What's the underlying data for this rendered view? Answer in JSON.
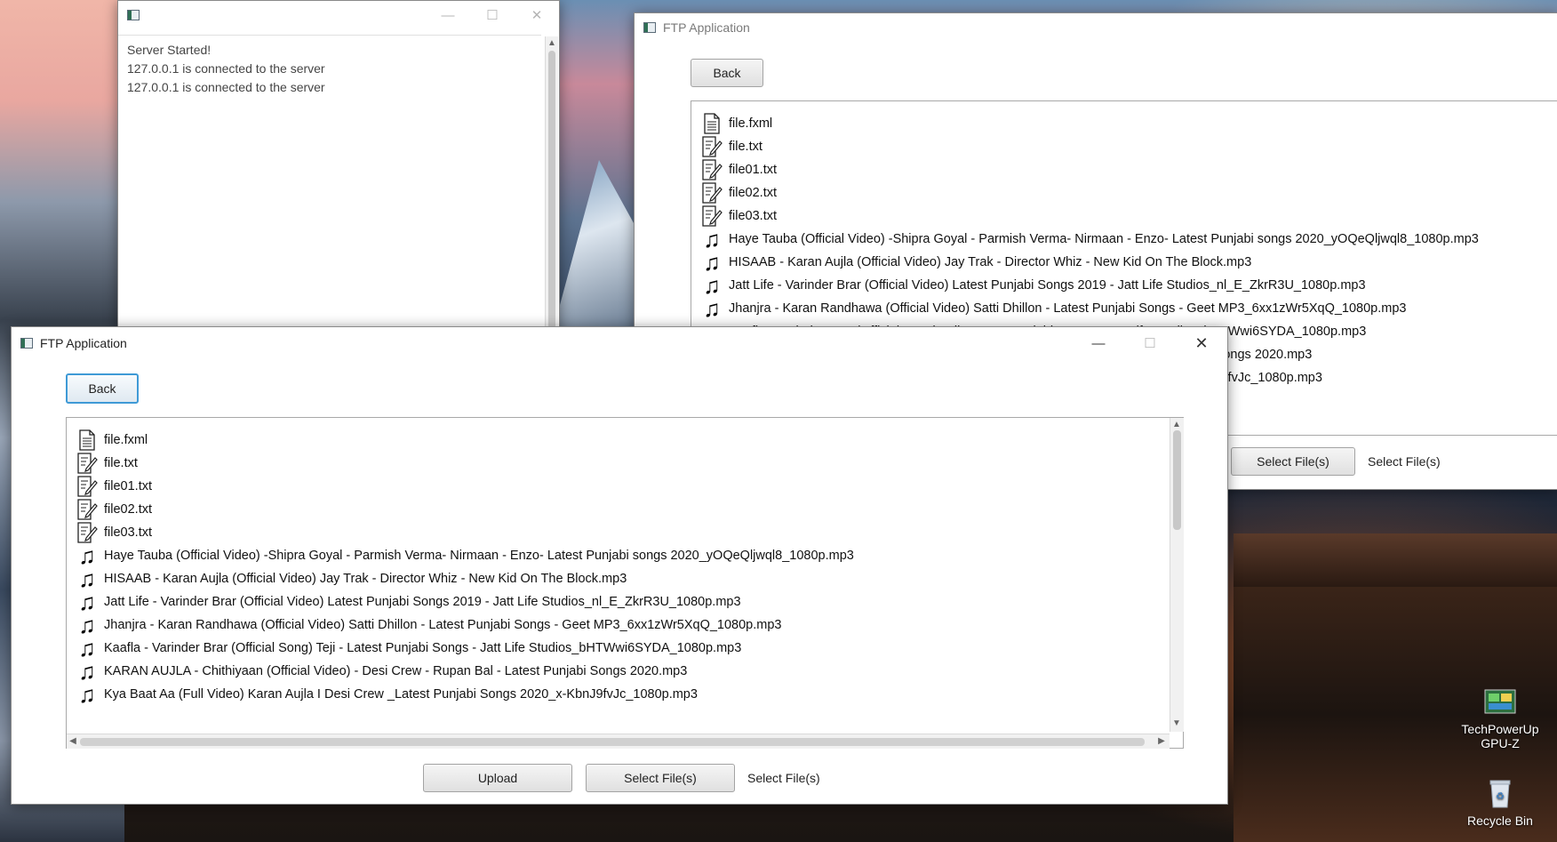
{
  "server_window": {
    "title": "",
    "log_lines": [
      "Server Started!",
      "127.0.0.1 is connected to the server",
      "127.0.0.1 is connected to the server"
    ]
  },
  "bg_window": {
    "title": "FTP Application",
    "back_label": "Back",
    "select_button_label": "Select File(s)",
    "select_status": "Select File(s)",
    "files": [
      {
        "icon": "document-icon",
        "name": "file.fxml"
      },
      {
        "icon": "text-file-icon",
        "name": "file.txt"
      },
      {
        "icon": "text-file-icon",
        "name": "file01.txt"
      },
      {
        "icon": "text-file-icon",
        "name": "file02.txt"
      },
      {
        "icon": "text-file-icon",
        "name": "file03.txt"
      },
      {
        "icon": "music-note-icon",
        "name": "Haye Tauba (Official Video) -Shipra Goyal - Parmish Verma- Nirmaan - Enzo- Latest Punjabi songs 2020_yOQeQljwql8_1080p.mp3"
      },
      {
        "icon": "music-note-icon",
        "name": "HISAAB - Karan Aujla (Official Video) Jay Trak - Director Whiz - New Kid On The Block.mp3"
      },
      {
        "icon": "music-note-icon",
        "name": "Jatt Life - Varinder Brar (Official Video) Latest Punjabi Songs 2019 - Jatt Life Studios_nl_E_ZkrR3U_1080p.mp3"
      },
      {
        "icon": "music-note-icon",
        "name": "Jhanjra - Karan Randhawa (Official Video) Satti Dhillon - Latest Punjabi Songs - Geet MP3_6xx1zWr5XqQ_1080p.mp3"
      },
      {
        "icon": "music-note-icon",
        "name": "Kaafla - Varinder Brar (Official Song) Teji - Latest Punjabi Songs - Jatt Life Studios_bHTWwi6SYDA_1080p.mp3"
      },
      {
        "icon": "music-note-icon",
        "name": "KARAN AUJLA - Chithiyaan (Official Video) - Desi Crew - Rupan Bal - Latest Punjabi Songs 2020.mp3"
      },
      {
        "icon": "music-note-icon",
        "name": "Kya Baat Aa (Full Video) Karan Aujla I Desi Crew _Latest Punjabi Songs 2020_x-KbnJ9fvJc_1080p.mp3"
      }
    ]
  },
  "main_window": {
    "title": "FTP Application",
    "back_label": "Back",
    "upload_label": "Upload",
    "select_button_label": "Select File(s)",
    "select_status": "Select File(s)",
    "files": [
      {
        "icon": "document-icon",
        "name": "file.fxml"
      },
      {
        "icon": "text-file-icon",
        "name": "file.txt"
      },
      {
        "icon": "text-file-icon",
        "name": "file01.txt"
      },
      {
        "icon": "text-file-icon",
        "name": "file02.txt"
      },
      {
        "icon": "text-file-icon",
        "name": "file03.txt"
      },
      {
        "icon": "music-note-icon",
        "name": "Haye Tauba (Official Video) -Shipra Goyal - Parmish Verma- Nirmaan - Enzo- Latest Punjabi songs 2020_yOQeQljwql8_1080p.mp3"
      },
      {
        "icon": "music-note-icon",
        "name": "HISAAB - Karan Aujla (Official Video) Jay Trak - Director Whiz - New Kid On The Block.mp3"
      },
      {
        "icon": "music-note-icon",
        "name": "Jatt Life - Varinder Brar (Official Video) Latest Punjabi Songs 2019 - Jatt Life Studios_nl_E_ZkrR3U_1080p.mp3"
      },
      {
        "icon": "music-note-icon",
        "name": "Jhanjra - Karan Randhawa (Official Video) Satti Dhillon - Latest Punjabi Songs - Geet MP3_6xx1zWr5XqQ_1080p.mp3"
      },
      {
        "icon": "music-note-icon",
        "name": "Kaafla - Varinder Brar (Official Song) Teji - Latest Punjabi Songs - Jatt Life Studios_bHTWwi6SYDA_1080p.mp3"
      },
      {
        "icon": "music-note-icon",
        "name": "KARAN AUJLA - Chithiyaan (Official Video) - Desi Crew - Rupan Bal - Latest Punjabi Songs 2020.mp3"
      },
      {
        "icon": "music-note-icon",
        "name": "Kya Baat Aa (Full Video) Karan Aujla I Desi Crew _Latest Punjabi Songs 2020_x-KbnJ9fvJc_1080p.mp3"
      }
    ]
  },
  "desktop_icons": [
    {
      "label": "TechPowerUp GPU-Z",
      "icon": "gpu-z-icon"
    },
    {
      "label": "Recycle Bin",
      "icon": "recycle-bin-icon"
    }
  ]
}
